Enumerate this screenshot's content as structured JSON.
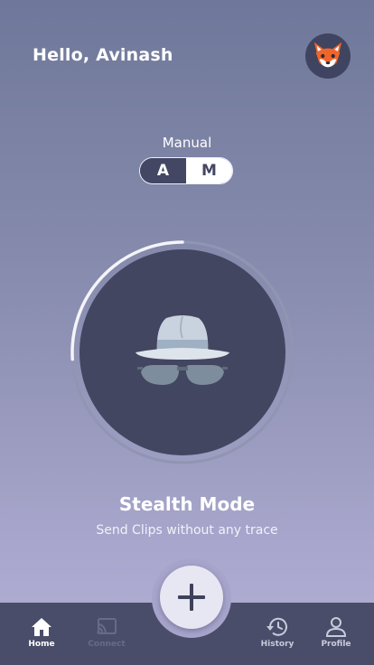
{
  "header": {
    "greeting": "Hello, Avinash",
    "avatar_icon": "fox-icon"
  },
  "mode": {
    "label": "Manual",
    "options": [
      "A",
      "M"
    ],
    "selected": "M"
  },
  "progress": {
    "value": 0.26
  },
  "feature": {
    "icon": "incognito-hat-glasses-icon",
    "title": "Stealth Mode",
    "subtitle": "Send Clips without any trace"
  },
  "fab": {
    "icon": "plus-icon"
  },
  "nav": {
    "items": [
      {
        "label": "Home",
        "icon": "home-icon",
        "state": "active"
      },
      {
        "label": "Connect",
        "icon": "cast-icon",
        "state": "disabled"
      },
      {
        "label": "History",
        "icon": "history-icon",
        "state": "normal"
      },
      {
        "label": "Profile",
        "icon": "person-icon",
        "state": "normal"
      }
    ]
  },
  "colors": {
    "dark": "#434661",
    "accent_light": "#e6e7f2",
    "fox_orange": "#f0652b"
  }
}
